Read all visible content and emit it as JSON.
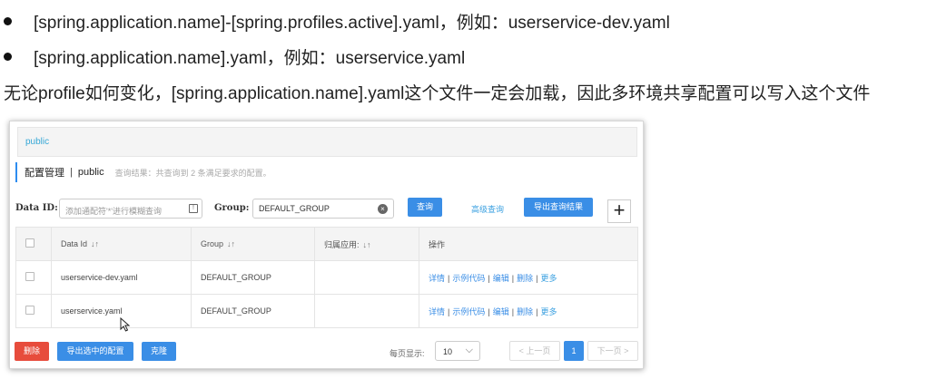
{
  "doc": {
    "bullet1": "[spring.application.name]-[spring.profiles.active].yaml，例如：userservice-dev.yaml",
    "bullet2": "[spring.application.name].yaml，例如：userservice.yaml",
    "paragraph": "无论profile如何变化，[spring.application.name].yaml这个文件一定会加载，因此多环境共享配置可以写入这个文件"
  },
  "app": {
    "namespace_tab": "public",
    "title": "配置管理",
    "separator": "|",
    "namespace": "public",
    "query_hint": "查询结果：共查询到 2 条满足要求的配置。",
    "filter": {
      "data_id_label": "Data ID:",
      "data_id_placeholder": "添加通配符'*'进行模糊查询",
      "group_label": "Group:",
      "group_value": "DEFAULT_GROUP",
      "query_button": "查询",
      "advanced_link": "高级查询",
      "export_button": "导出查询结果",
      "add_button": "+"
    },
    "table": {
      "headers": [
        "Data Id",
        "Group",
        "归属应用:",
        "操作"
      ],
      "rows": [
        {
          "data_id": "userservice-dev.yaml",
          "group": "DEFAULT_GROUP",
          "app": ""
        },
        {
          "data_id": "userservice.yaml",
          "group": "DEFAULT_GROUP",
          "app": ""
        }
      ],
      "ops": [
        "详情",
        "示例代码",
        "编辑",
        "删除",
        "更多"
      ]
    },
    "footer": {
      "delete_button": "删除",
      "export_selected_button": "导出选中的配置",
      "clone_button": "克隆",
      "page_size_label": "每页显示:",
      "page_size_value": "10",
      "prev_label": "< 上一页",
      "current_page": "1",
      "next_label": "下一页 >"
    }
  },
  "colors": {
    "primary": "#3a8ee6",
    "danger": "#e74c3c",
    "link": "#3aa0e0"
  }
}
